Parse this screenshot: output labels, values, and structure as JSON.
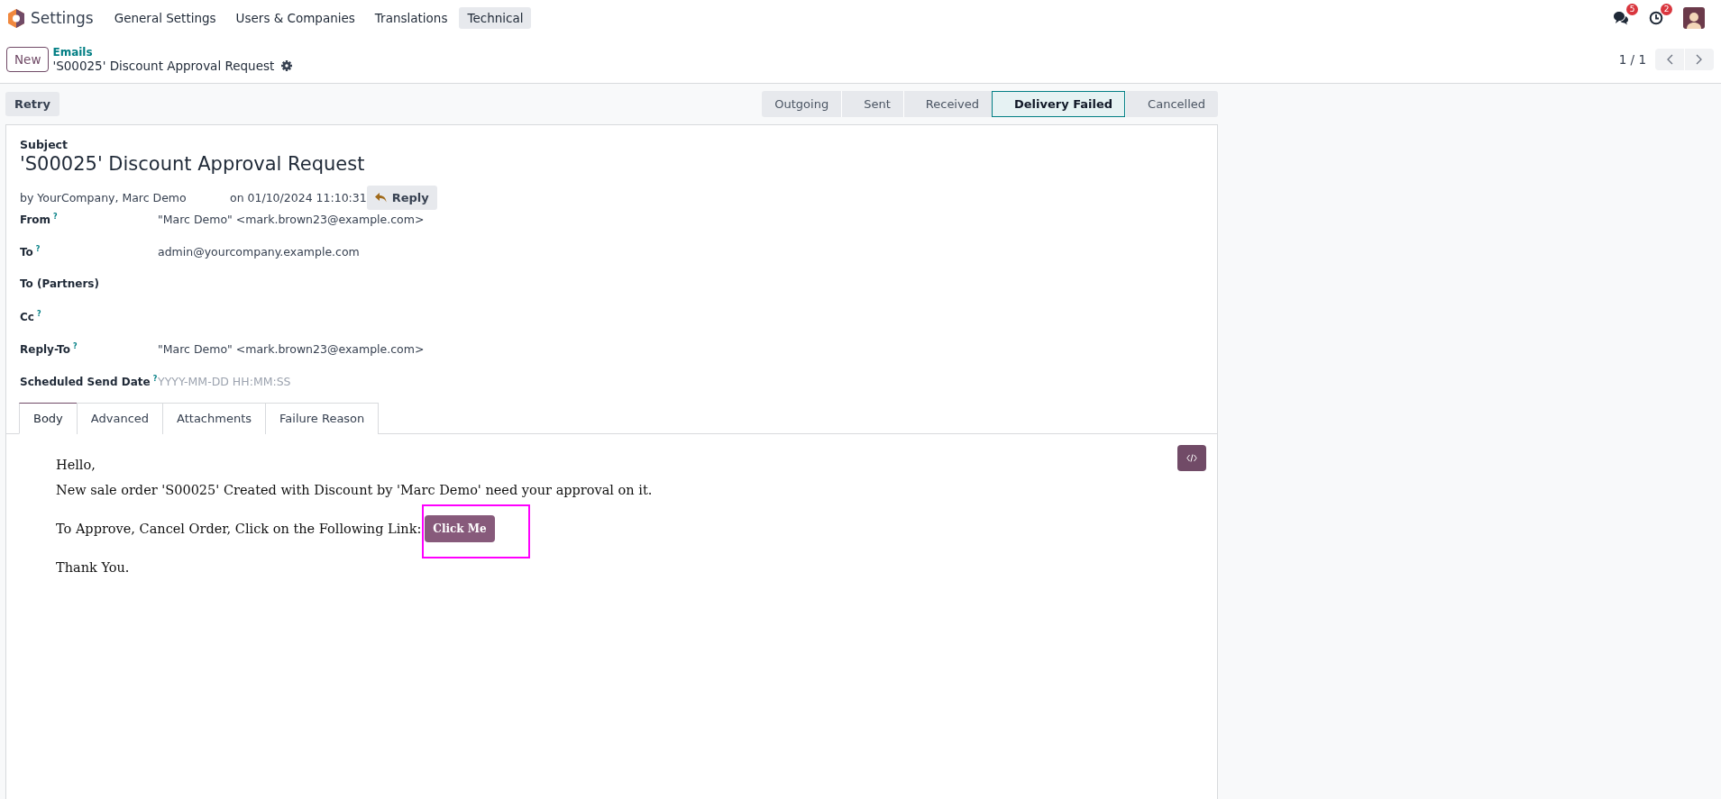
{
  "app": {
    "name": "Settings"
  },
  "menu": [
    {
      "label": "General Settings",
      "selected": false
    },
    {
      "label": "Users & Companies",
      "selected": false
    },
    {
      "label": "Translations",
      "selected": false
    },
    {
      "label": "Technical",
      "selected": true
    }
  ],
  "systray": [
    {
      "kind": "chat",
      "count": "5"
    },
    {
      "kind": "activity",
      "count": "2"
    }
  ],
  "control_panel": {
    "new_button": "New",
    "breadcrumb": "Emails",
    "record_title": "'S00025' Discount Approval Request",
    "pager": "1 / 1"
  },
  "retry_button": "Retry",
  "stages": [
    {
      "label": "Outgoing",
      "selected": false
    },
    {
      "label": "Sent",
      "selected": false
    },
    {
      "label": "Received",
      "selected": false
    },
    {
      "label": "Delivery Failed",
      "selected": true
    },
    {
      "label": "Cancelled",
      "selected": false
    }
  ],
  "subject": {
    "label": "Subject",
    "value": "'S00025' Discount Approval Request"
  },
  "meta": {
    "author": "by YourCompany, Marc Demo",
    "date": "on 01/10/2024 11:10:31",
    "reply_button": "Reply"
  },
  "fields": [
    {
      "label": "From",
      "help": "?",
      "value": "\"Marc Demo\" <mark.brown23@example.com>"
    },
    {
      "label": "To",
      "help": "?",
      "value": "admin@yourcompany.example.com"
    },
    {
      "label": "To (Partners)"
    },
    {
      "label": "Cc",
      "help": "?"
    },
    {
      "label": "Reply-To",
      "help": "?",
      "value": "\"Marc Demo\" <mark.brown23@example.com>"
    },
    {
      "label": "Scheduled Send Date",
      "help": "?",
      "placeholder": "YYYY-MM-DD HH:MM:SS"
    }
  ],
  "tabs": [
    {
      "label": "Body",
      "selected": true
    },
    {
      "label": "Advanced",
      "selected": false
    },
    {
      "label": "Attachments",
      "selected": false
    },
    {
      "label": "Failure Reason",
      "selected": false
    }
  ],
  "body": [
    {
      "text": "Hello,"
    },
    {
      "text": "New sale order 'S00025' Created with Discount by 'Marc Demo' need your approval on it."
    },
    {
      "text": "To Approve, Cancel Order, Click on the Following Link:",
      "link": "Click Me",
      "highlighted": true
    },
    {
      "text": "Thank You."
    }
  ]
}
